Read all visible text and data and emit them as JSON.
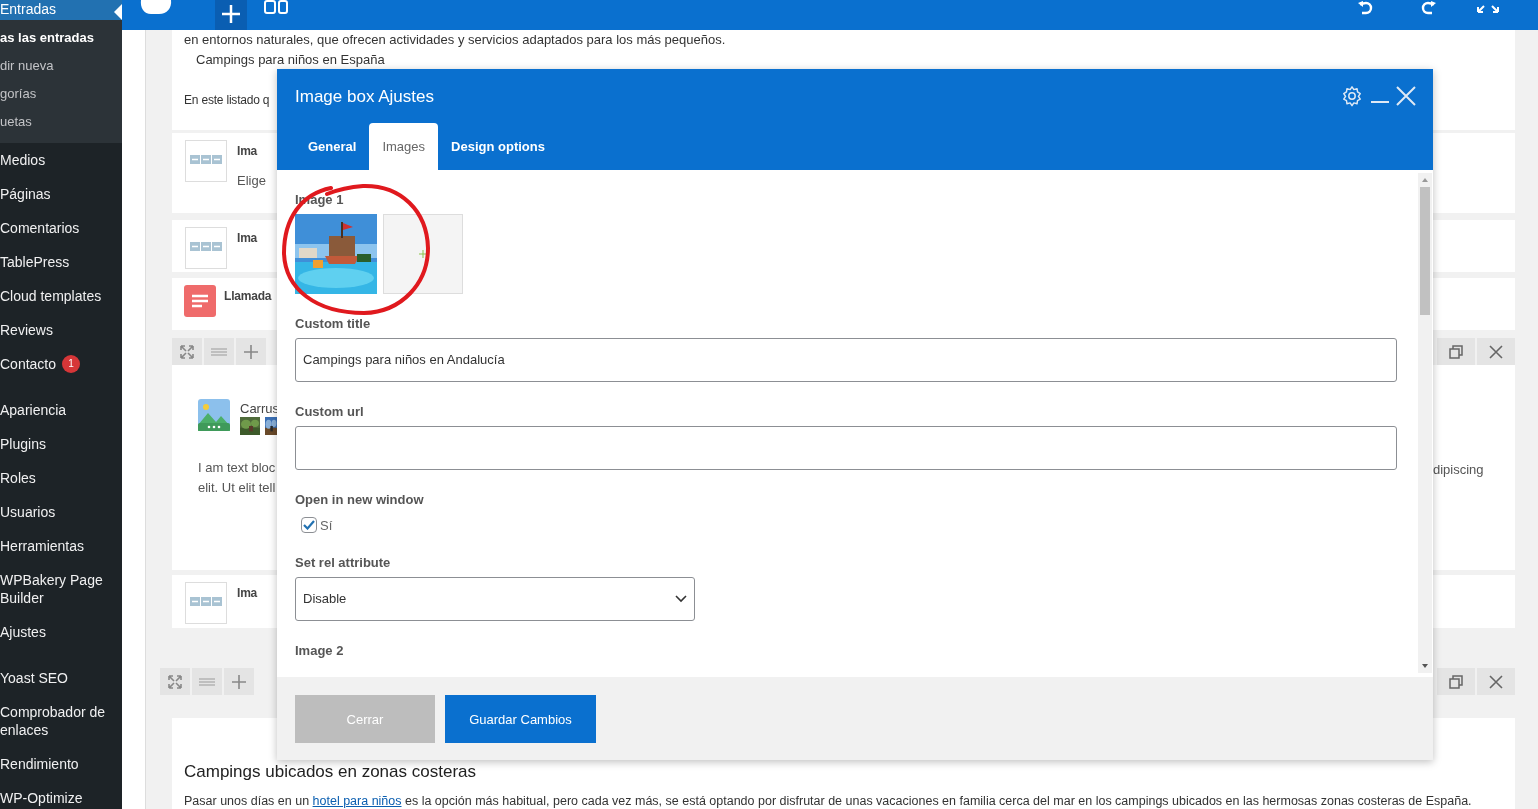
{
  "sidebar": {
    "current": {
      "label": "Entradas",
      "selected": true,
      "submenu": [
        {
          "label": "as las entradas",
          "selected": true
        },
        {
          "label": "dir nueva",
          "selected": false
        },
        {
          "label": "gorías",
          "selected": false
        },
        {
          "label": "uetas",
          "selected": false
        }
      ]
    },
    "items": [
      {
        "kind": "item",
        "label": "Medios",
        "selected": false
      },
      {
        "kind": "item",
        "label": "Páginas",
        "selected": false
      },
      {
        "kind": "item",
        "label": "Comentarios",
        "selected": false
      },
      {
        "kind": "item",
        "label": "TablePress",
        "selected": false
      },
      {
        "kind": "item",
        "label": "Cloud templates",
        "selected": false
      },
      {
        "kind": "item",
        "label": "Reviews",
        "selected": false
      },
      {
        "kind": "item",
        "label": "Contacto",
        "selected": false,
        "badge": "1"
      },
      {
        "kind": "separator"
      },
      {
        "kind": "item",
        "label": "Apariencia",
        "selected": false
      },
      {
        "kind": "item",
        "label": "Plugins",
        "selected": false
      },
      {
        "kind": "item",
        "label": "Roles",
        "selected": false
      },
      {
        "kind": "item",
        "label": "Usuarios",
        "selected": false
      },
      {
        "kind": "item",
        "label": "Herramientas",
        "selected": false
      },
      {
        "kind": "item",
        "label": "WPBakery Page Builder",
        "selected": false
      },
      {
        "kind": "item",
        "label": "Ajustes",
        "selected": false
      },
      {
        "kind": "separator"
      },
      {
        "kind": "item",
        "label": "Yoast SEO",
        "selected": false
      },
      {
        "kind": "item",
        "label": "Comprobador de enlaces",
        "selected": false
      },
      {
        "kind": "item",
        "label": "Rendimiento",
        "selected": false
      },
      {
        "kind": "item",
        "label": "WP-Optimize",
        "selected": false
      }
    ]
  },
  "editor": {
    "intro": "en entornos naturales, que ofrecen actividades y servicios adaptados para los más pequeños.",
    "subtitle": "Campings para niños en España",
    "lead": "En este listado q",
    "elements": [
      {
        "kind": "image-box",
        "title": "Ima",
        "subtitle": "Elige"
      },
      {
        "kind": "image-box",
        "title": "Ima"
      },
      {
        "kind": "text-block",
        "title": "Llamada"
      }
    ],
    "carousel": {
      "title": "Carrus",
      "text": "I am text bloc",
      "text_2": "elit. Ut elit tell",
      "text_right": "dipiscing"
    },
    "last_element": {
      "kind": "image-box",
      "title": "Ima"
    },
    "section": {
      "heading": "Campings ubicados en zonas costeras",
      "paragraph": {
        "before": "Pasar unos días en un ",
        "link": "hotel para niños",
        "after": " es la opción más habitual, pero cada vez más, se está optando por disfrutar de unas vacaciones en familia cerca del mar en los campings ubicados en las hermosas zonas costeras de España."
      }
    }
  },
  "modal": {
    "title": "Image box Ajustes",
    "tabs": [
      {
        "label": "General",
        "selected": false
      },
      {
        "label": "Images",
        "selected": true
      },
      {
        "label": "Design options",
        "selected": false
      }
    ],
    "fields": [
      {
        "kind": "images",
        "label": "Image 1",
        "slots": [
          {
            "kind": "picture"
          },
          {
            "kind": "add"
          }
        ]
      },
      {
        "kind": "text",
        "label": "Custom title",
        "value": "Campings para niños en Andalucía"
      },
      {
        "kind": "text",
        "label": "Custom url"
      },
      {
        "kind": "checkbox",
        "label": "Open in new window",
        "option": "Sí",
        "checked": true
      },
      {
        "kind": "select",
        "label": "Set rel attribute",
        "value": "Disable"
      },
      {
        "kind": "images",
        "label": "Image 2"
      }
    ],
    "buttons": [
      {
        "label": "Cerrar",
        "kind": "secondary"
      },
      {
        "label": "Guardar Cambios",
        "kind": "primary"
      }
    ]
  }
}
